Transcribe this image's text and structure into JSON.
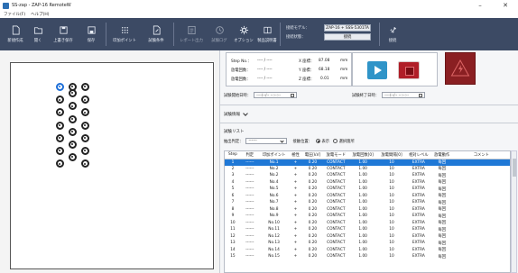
{
  "window": {
    "title": "SS-zap - ZAP-16 RemoteW",
    "minimize": "–",
    "close": "✕"
  },
  "menu": [
    "ファイル(F)",
    "ヘルプ(H)"
  ],
  "toolbar": {
    "buttons": [
      {
        "label": "新規作成",
        "icon": "new-file-icon"
      },
      {
        "label": "開く",
        "icon": "folder-open-icon"
      },
      {
        "label": "上書き保存",
        "icon": "save-icon"
      },
      {
        "label": "保存",
        "icon": "save-as-icon"
      },
      {
        "label": "印加ポイント",
        "icon": "grid-points-icon"
      },
      {
        "label": "試験条件",
        "icon": "document-settings-icon"
      },
      {
        "label": "レポート出力",
        "icon": "report-icon"
      },
      {
        "label": "試験ログ",
        "icon": "clock-icon"
      },
      {
        "label": "オプション",
        "icon": "gear-icon"
      },
      {
        "label": "製品説明書",
        "icon": "book-icon"
      },
      {
        "label": "接続",
        "icon": "connect-icon"
      }
    ],
    "connection": {
      "model_label": "接続モデル：",
      "model_value": "ZAP-16 + SSS-5301TA",
      "state_label": "接続状態：",
      "state_value": "接続"
    }
  },
  "status": {
    "step_label": "Step No.：",
    "step_value": "---- / ----",
    "discharge_count_label": "放電回数：",
    "discharge_count_value": "---- / ----",
    "discharge_interval_label": "放電回数：",
    "discharge_interval_value": "---- / ----",
    "x_label": "X 座標：",
    "x_value": "87.08",
    "y_label": "Y 座標：",
    "y_value": "68.18",
    "z_label": "Z 座標：",
    "z_value": "0.01",
    "unit": "mm"
  },
  "dates": {
    "start_label": "試験開始日時：",
    "start_value": "----/--/-- --:--:--",
    "end_label": "試験終了日時：",
    "end_value": "----/--/-- --:--:--"
  },
  "info_label": "試験情報",
  "list": {
    "title": "試験リスト",
    "filter_label": "抽出判定：",
    "filter_value": "------",
    "position_label": "接触位置：",
    "radio1": "表示",
    "radio2": "選択箇所",
    "columns": [
      "Step",
      "判定",
      "印加ポイント",
      "極性",
      "電圧[kV]",
      "放電モード",
      "放電回数[0]",
      "放電間隔[0]",
      "相対レベル",
      "放電動作",
      "コメント"
    ],
    "rows": [
      [
        "1",
        "------",
        "No.1",
        "+",
        "0.20",
        "CONTACT",
        "1.00",
        "10",
        "EXTRA",
        "毎回",
        ""
      ],
      [
        "2",
        "------",
        "No.2",
        "+",
        "0.20",
        "CONTACT",
        "1.00",
        "10",
        "EXTRA",
        "毎回",
        ""
      ],
      [
        "3",
        "------",
        "No.2",
        "+",
        "0.20",
        "CONTACT",
        "1.00",
        "10",
        "EXTRA",
        "毎回",
        ""
      ],
      [
        "4",
        "------",
        "No.4",
        "+",
        "0.20",
        "CONTACT",
        "1.00",
        "10",
        "EXTRA",
        "毎回",
        ""
      ],
      [
        "5",
        "------",
        "No.5",
        "+",
        "0.20",
        "CONTACT",
        "1.00",
        "10",
        "EXTRA",
        "毎回",
        ""
      ],
      [
        "6",
        "------",
        "No.6",
        "+",
        "0.20",
        "CONTACT",
        "1.00",
        "10",
        "EXTRA",
        "毎回",
        ""
      ],
      [
        "7",
        "------",
        "No.7",
        "+",
        "0.20",
        "CONTACT",
        "1.00",
        "10",
        "EXTRA",
        "毎回",
        ""
      ],
      [
        "8",
        "------",
        "No.8",
        "+",
        "0.20",
        "CONTACT",
        "1.00",
        "10",
        "EXTRA",
        "毎回",
        ""
      ],
      [
        "9",
        "------",
        "No.9",
        "+",
        "0.20",
        "CONTACT",
        "1.00",
        "10",
        "EXTRA",
        "毎回",
        ""
      ],
      [
        "10",
        "------",
        "No.10",
        "+",
        "0.20",
        "CONTACT",
        "1.00",
        "10",
        "EXTRA",
        "毎回",
        ""
      ],
      [
        "11",
        "------",
        "No.11",
        "+",
        "0.20",
        "CONTACT",
        "1.00",
        "10",
        "EXTRA",
        "毎回",
        ""
      ],
      [
        "12",
        "------",
        "No.12",
        "+",
        "0.20",
        "CONTACT",
        "1.00",
        "10",
        "EXTRA",
        "毎回",
        ""
      ],
      [
        "13",
        "------",
        "No.13",
        "+",
        "0.20",
        "CONTACT",
        "1.00",
        "10",
        "EXTRA",
        "毎回",
        ""
      ],
      [
        "14",
        "------",
        "No.14",
        "+",
        "0.20",
        "CONTACT",
        "1.00",
        "10",
        "EXTRA",
        "毎回",
        ""
      ],
      [
        "15",
        "------",
        "No.15",
        "+",
        "0.20",
        "CONTACT",
        "1.00",
        "10",
        "EXTRA",
        "毎回",
        ""
      ]
    ],
    "selected_row": 0
  },
  "colors": {
    "toolbar": "#3c4a64",
    "selection": "#1f78d6",
    "play": "#2f94c8",
    "stop": "#b01e28",
    "alarm": "#8a1f22"
  }
}
